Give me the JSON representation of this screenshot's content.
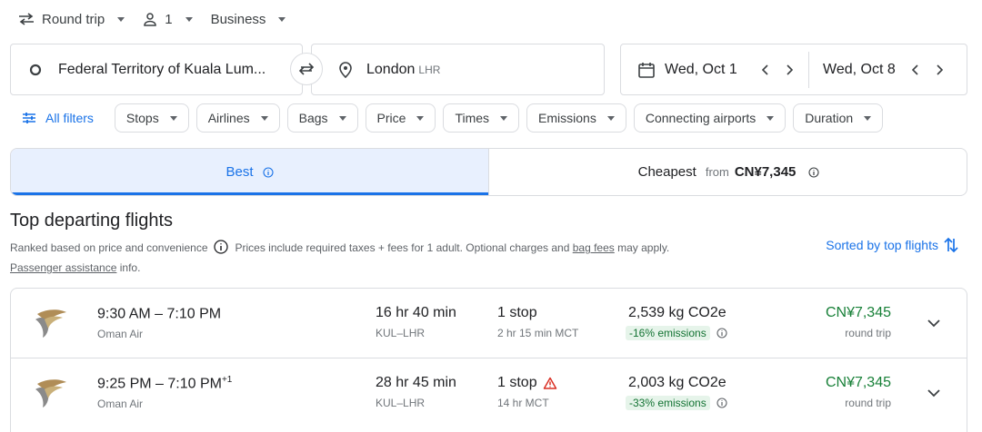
{
  "options": {
    "trip_type": "Round trip",
    "passengers": "1",
    "cabin": "Business"
  },
  "search": {
    "origin": "Federal Territory of Kuala Lum...",
    "destination": "London",
    "destination_code": "LHR",
    "depart_date": "Wed, Oct 1",
    "return_date": "Wed, Oct 8"
  },
  "filters": {
    "all_filters": "All filters",
    "chips": [
      "Stops",
      "Airlines",
      "Bags",
      "Price",
      "Times",
      "Emissions",
      "Connecting airports",
      "Duration"
    ]
  },
  "tabs": {
    "best": "Best",
    "cheapest": "Cheapest",
    "cheapest_from": "from",
    "cheapest_price": "CN¥7,345"
  },
  "results": {
    "heading": "Top departing flights",
    "ranked_text": "Ranked based on price and convenience",
    "prices_text": "Prices include required taxes + fees for 1 adult. Optional charges and",
    "bag_fees": "bag fees",
    "may_apply": "may apply.",
    "passenger_assistance": "Passenger assistance",
    "info_suffix": "info.",
    "sorted_label": "Sorted by top flights"
  },
  "flights": [
    {
      "times": "9:30 AM – 7:10 PM",
      "day_offset": "",
      "airline": "Oman Air",
      "duration": "16 hr 40 min",
      "route": "KUL–LHR",
      "stops": "1 stop",
      "stop_warning": false,
      "layover": "2 hr 15 min MCT",
      "emissions": "2,539 kg CO2e",
      "emissions_delta": "-16% emissions",
      "price": "CN¥7,345",
      "price_note": "round trip"
    },
    {
      "times": "9:25 PM – 7:10 PM",
      "day_offset": "+1",
      "airline": "Oman Air",
      "duration": "28 hr 45 min",
      "route": "KUL–LHR",
      "stops": "1 stop",
      "stop_warning": true,
      "layover": "14 hr MCT",
      "emissions": "2,003 kg CO2e",
      "emissions_delta": "-33% emissions",
      "price": "CN¥7,345",
      "price_note": "round trip"
    }
  ]
}
